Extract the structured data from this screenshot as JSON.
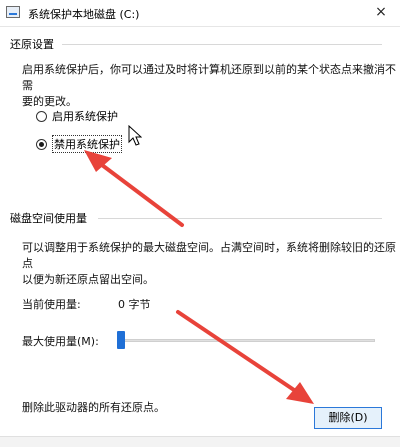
{
  "window": {
    "title": "系统保护本地磁盘 (C:)",
    "close_glyph": "×"
  },
  "restore": {
    "section_title": "还原设置",
    "description_lines": [
      "启用系统保护后，你可以通过及时将计算机还原到以前的某个状态点来撤消不需",
      "要的更改。"
    ],
    "options": [
      {
        "label": "启用系统保护",
        "selected": false
      },
      {
        "label": "禁用系统保护",
        "selected": true
      }
    ]
  },
  "disk": {
    "section_title": "磁盘空间使用量",
    "description_lines": [
      "可以调整用于系统保护的最大磁盘空间。占满空间时，系统将删除较旧的还原点",
      "以便为新还原点留出空间。"
    ],
    "current_usage_label": "当前使用量:",
    "current_usage_value": "0 字节",
    "max_usage_label": "最大使用量(M):",
    "max_usage_level": 0.0,
    "delete_text": "删除此驱动器的所有还原点。",
    "delete_button": "删除(D)"
  },
  "colors": {
    "accent": "#1f6fd6",
    "annotation_arrow": "#e8433a"
  }
}
